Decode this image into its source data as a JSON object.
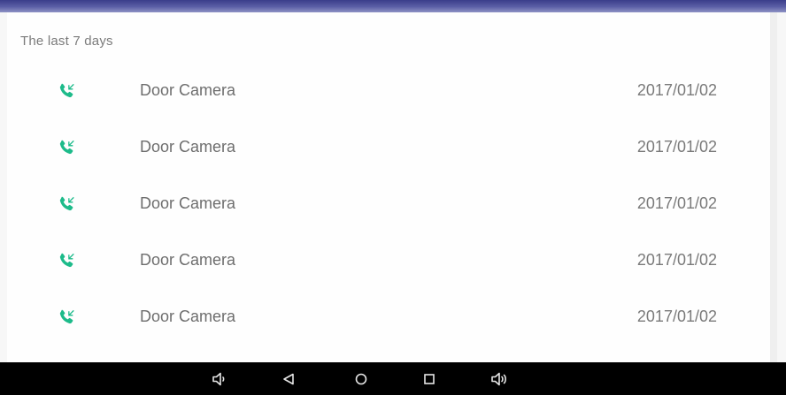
{
  "call_log": {
    "section_title": "The last 7 days",
    "items": [
      {
        "name": "Door Camera",
        "date": "2017/01/02",
        "icon": "incoming-call-icon"
      },
      {
        "name": "Door Camera",
        "date": "2017/01/02",
        "icon": "incoming-call-icon"
      },
      {
        "name": "Door Camera",
        "date": "2017/01/02",
        "icon": "incoming-call-icon"
      },
      {
        "name": "Door Camera",
        "date": "2017/01/02",
        "icon": "incoming-call-icon"
      },
      {
        "name": "Door Camera",
        "date": "2017/01/02",
        "icon": "incoming-call-icon"
      }
    ]
  },
  "nav_bar": {
    "buttons": [
      "volume-down-icon",
      "back-icon",
      "home-icon",
      "recents-icon",
      "volume-up-icon"
    ]
  },
  "colors": {
    "accent_green": "#1dbb8a",
    "header_gradient": "#3a3d8a",
    "nav_bar": "#000000"
  }
}
